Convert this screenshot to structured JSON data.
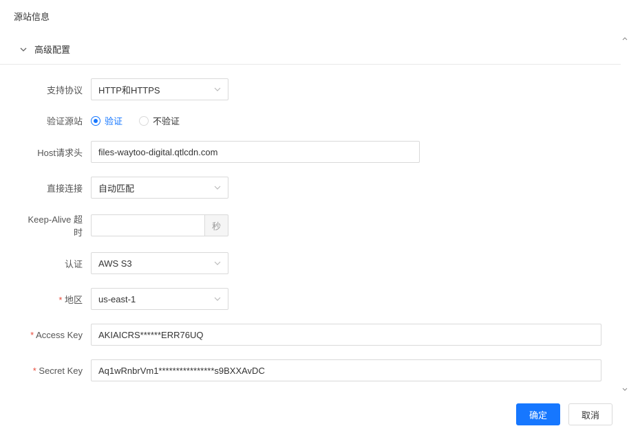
{
  "header": {
    "title": "源站信息"
  },
  "section": {
    "title": "高级配置"
  },
  "form": {
    "protocol": {
      "label": "支持协议",
      "value": "HTTP和HTTPS"
    },
    "verify": {
      "label": "验证源站",
      "option_yes": "验证",
      "option_no": "不验证"
    },
    "host": {
      "label": "Host请求头",
      "value": "files-waytoo-digital.qtlcdn.com"
    },
    "direct": {
      "label": "直接连接",
      "value": "自动匹配"
    },
    "keepalive": {
      "label": "Keep-Alive 超时",
      "value": "",
      "suffix": "秒"
    },
    "auth": {
      "label": "认证",
      "value": "AWS S3"
    },
    "region": {
      "label": "地区",
      "value": "us-east-1"
    },
    "access_key": {
      "label": "Access Key",
      "value": "AKIAICRS******ERR76UQ"
    },
    "secret_key": {
      "label": "Secret Key",
      "value": "Aq1wRnbrVm1****************s9BXXAvDC"
    }
  },
  "footer": {
    "confirm": "确定",
    "cancel": "取消"
  }
}
